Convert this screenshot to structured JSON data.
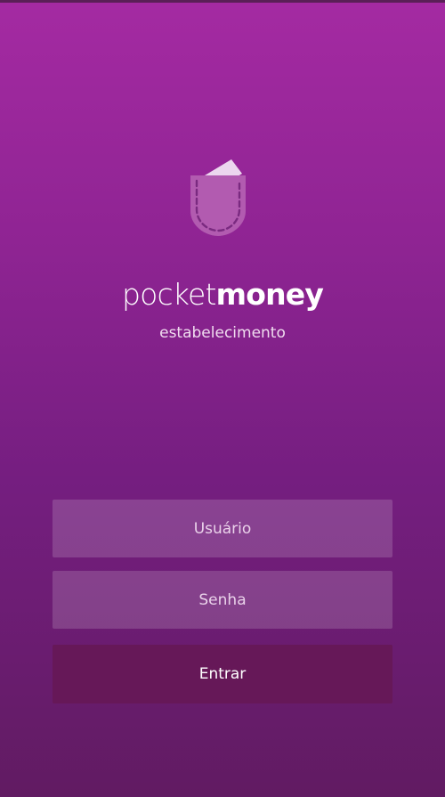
{
  "brand": {
    "name_light": "pocket",
    "name_bold": "money",
    "subtitle": "estabelecimento",
    "logo_icon": "pocket-wallet-icon"
  },
  "login": {
    "username_placeholder": "Usuário",
    "password_placeholder": "Senha",
    "submit_label": "Entrar"
  },
  "colors": {
    "gradient_top": "#a42aa2",
    "gradient_bottom": "#611b62",
    "button_bg": "#661858",
    "text": "#ffffff"
  }
}
